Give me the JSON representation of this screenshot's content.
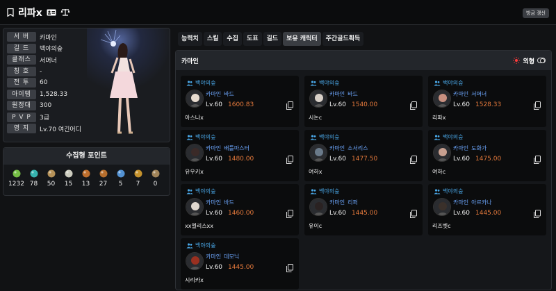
{
  "header": {
    "name": "리파x",
    "refresh_label": "방금 갱신"
  },
  "profile": {
    "stats": [
      {
        "label": "서 버",
        "value": "카마인"
      },
      {
        "label": "길 드",
        "value": "백야의숲"
      },
      {
        "label": "클래스",
        "value": "서머너"
      },
      {
        "label": "칭 호",
        "value": "-"
      },
      {
        "label": "전 투",
        "value": "60"
      },
      {
        "label": "아이템",
        "value": "1,528.33"
      },
      {
        "label": "원정대",
        "value": "300"
      },
      {
        "label": "P V P",
        "value": "3급"
      },
      {
        "label": "영 지",
        "value": "Lv.70 여긴어디"
      }
    ]
  },
  "collection": {
    "title": "수집형 포인트",
    "items": [
      {
        "icon": "seed-icon",
        "count": "1232",
        "color": "#7fd04a"
      },
      {
        "icon": "island-heart-icon",
        "count": "78",
        "color": "#3ac4c0"
      },
      {
        "icon": "art-scroll-icon",
        "count": "50",
        "color": "#c8a060"
      },
      {
        "icon": "mokoko-icon",
        "count": "15",
        "color": "#e0e0d0"
      },
      {
        "icon": "giant-heart-icon",
        "count": "13",
        "color": "#d07830"
      },
      {
        "icon": "ignea-token-icon",
        "count": "27",
        "color": "#c87830"
      },
      {
        "icon": "sea-bounty-icon",
        "count": "5",
        "color": "#5aa0e8"
      },
      {
        "icon": "world-tree-leaf-icon",
        "count": "7",
        "color": "#d8a030"
      },
      {
        "icon": "orpheus-star-icon",
        "count": "0",
        "color": "#b09060"
      }
    ]
  },
  "tabs": [
    "능력치",
    "스킬",
    "수집",
    "도표",
    "길드",
    "보유 캐릭터",
    "주간골드획득"
  ],
  "active_tab": 5,
  "server_bar": {
    "title": "카마인",
    "toggle_label": "외형"
  },
  "accent_colors": {
    "guild": "#4aa8e8",
    "class": "#6ea8ff",
    "ilvl": "#e67a3c"
  },
  "characters": [
    {
      "guild": "백야의숲",
      "server": "카마인",
      "class": "바드",
      "level": "Lv.60",
      "ilvl": "1600.83",
      "name": "아스나x"
    },
    {
      "guild": "백야의숲",
      "server": "카마인",
      "class": "바드",
      "level": "Lv.60",
      "ilvl": "1540.00",
      "name": "시논c"
    },
    {
      "guild": "백야의숲",
      "server": "카마인",
      "class": "서머너",
      "level": "Lv.60",
      "ilvl": "1528.33",
      "name": "리파x"
    },
    {
      "guild": "백야의숲",
      "server": "카마인",
      "class": "배틀마스터",
      "level": "Lv.60",
      "ilvl": "1480.00",
      "name": "유우키x"
    },
    {
      "guild": "백야의숲",
      "server": "카마인",
      "class": "소서리스",
      "level": "Lv.60",
      "ilvl": "1477.50",
      "name": "여하x"
    },
    {
      "guild": "백야의숲",
      "server": "카마인",
      "class": "도화가",
      "level": "Lv.60",
      "ilvl": "1475.00",
      "name": "여하c"
    },
    {
      "guild": "백야의숲",
      "server": "카마인",
      "class": "바드",
      "level": "Lv.60",
      "ilvl": "1460.00",
      "name": "xx엘리스xx"
    },
    {
      "guild": "백야의숲",
      "server": "카마인",
      "class": "리퍼",
      "level": "Lv.60",
      "ilvl": "1445.00",
      "name": "유이c"
    },
    {
      "guild": "백야의숲",
      "server": "카마인",
      "class": "아르카나",
      "level": "Lv.60",
      "ilvl": "1445.00",
      "name": "리즈벳c"
    },
    {
      "guild": "백야의숲",
      "server": "카마인",
      "class": "데모닉",
      "level": "Lv.60",
      "ilvl": "1445.00",
      "name": "시리카x"
    }
  ]
}
